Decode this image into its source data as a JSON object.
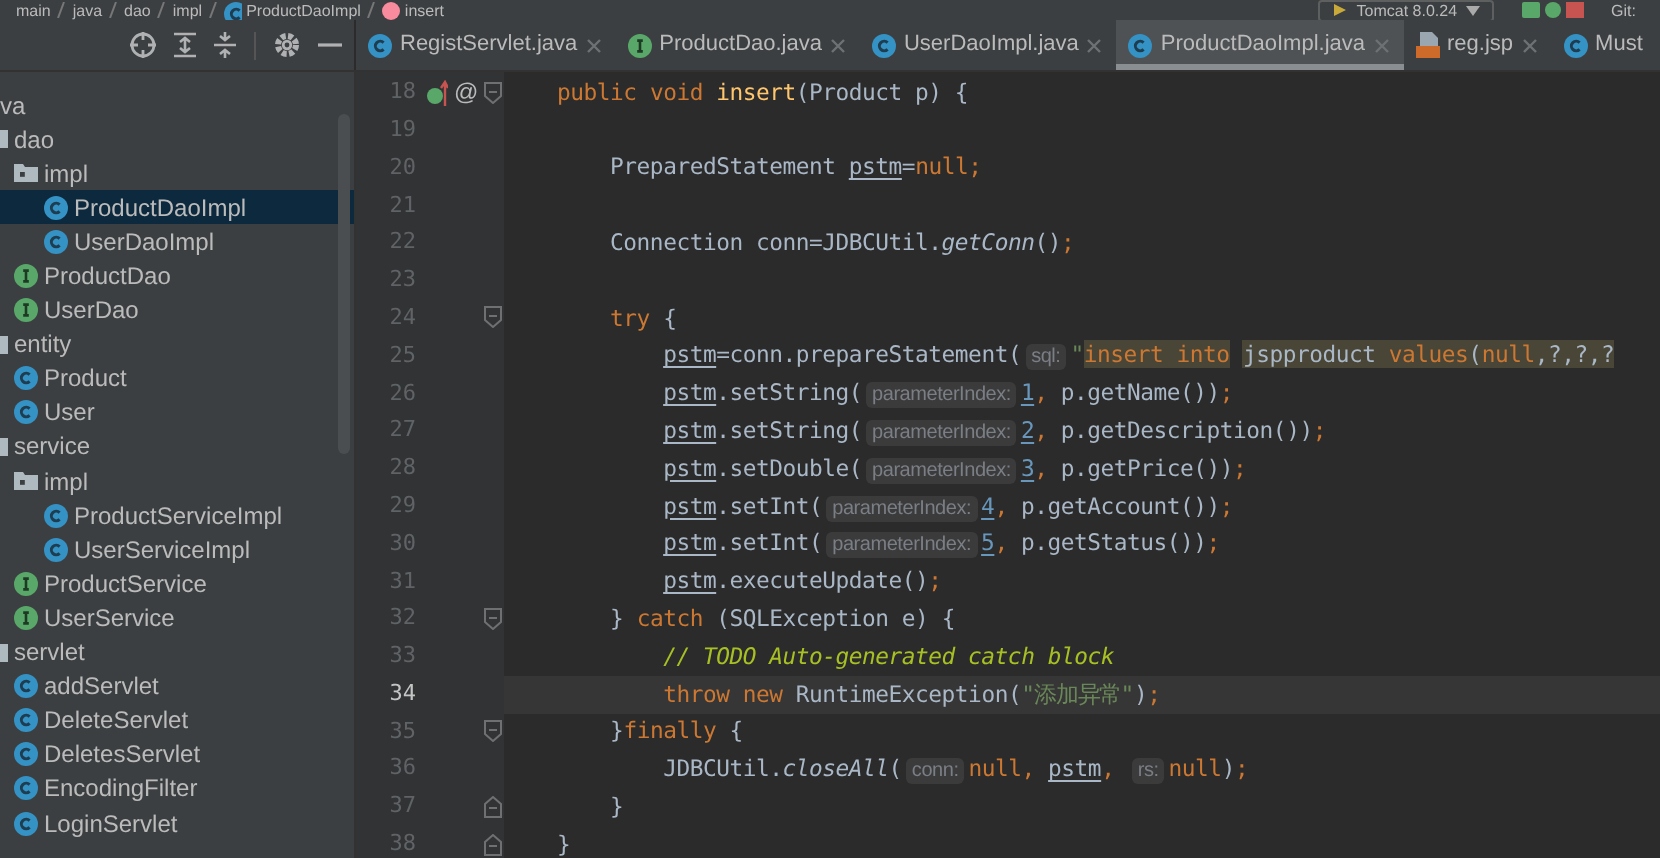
{
  "breadcrumb": [
    {
      "label": "main",
      "kind": "folder"
    },
    {
      "label": "java",
      "kind": "folder"
    },
    {
      "label": "dao",
      "kind": "folder"
    },
    {
      "label": "impl",
      "kind": "folder"
    },
    {
      "label": "ProductDaoImpl",
      "kind": "class"
    },
    {
      "label": "insert",
      "kind": "method"
    }
  ],
  "run_config": "Tomcat 8.0.24",
  "vcs_label": "Git:",
  "tabs": [
    {
      "label": "RegistServlet.java",
      "kind": "class",
      "selected": false
    },
    {
      "label": "ProductDao.java",
      "kind": "interface",
      "selected": false
    },
    {
      "label": "UserDaoImpl.java",
      "kind": "class",
      "selected": false
    },
    {
      "label": "ProductDaoImpl.java",
      "kind": "class",
      "selected": true
    },
    {
      "label": "reg.jsp",
      "kind": "jsp",
      "selected": false
    },
    {
      "label": "Must",
      "kind": "class",
      "selected": false
    }
  ],
  "project_tree": [
    {
      "label": "va",
      "selected": false,
      "children": [
        {
          "label": "dao",
          "kind": "package",
          "selected": false,
          "children": [
            {
              "label": "impl",
              "kind": "package",
              "selected": false,
              "children": [
                {
                  "label": "ProductDaoImpl",
                  "kind": "class",
                  "selected": true
                },
                {
                  "label": "UserDaoImpl",
                  "kind": "class",
                  "selected": false
                }
              ]
            },
            {
              "label": "ProductDao",
              "kind": "interface",
              "selected": false
            },
            {
              "label": "UserDao",
              "kind": "interface",
              "selected": false
            }
          ]
        },
        {
          "label": "entity",
          "kind": "package",
          "selected": false,
          "children": [
            {
              "label": "Product",
              "kind": "class",
              "selected": false
            },
            {
              "label": "User",
              "kind": "class",
              "selected": false
            }
          ]
        },
        {
          "label": "service",
          "kind": "package",
          "selected": false,
          "children": [
            {
              "label": "impl",
              "kind": "package",
              "selected": false,
              "children": [
                {
                  "label": "ProductServiceImpl",
                  "kind": "class",
                  "selected": false
                },
                {
                  "label": "UserServiceImpl",
                  "kind": "class",
                  "selected": false
                }
              ]
            },
            {
              "label": "ProductService",
              "kind": "interface",
              "selected": false
            },
            {
              "label": "UserService",
              "kind": "interface",
              "selected": false
            }
          ]
        },
        {
          "label": "servlet",
          "kind": "package",
          "selected": false,
          "children": [
            {
              "label": "addServlet",
              "kind": "class",
              "selected": false
            },
            {
              "label": "DeleteServlet",
              "kind": "class",
              "selected": false
            },
            {
              "label": "DeletesServlet",
              "kind": "class",
              "selected": false
            },
            {
              "label": "EncodingFilter",
              "kind": "class",
              "selected": false
            },
            {
              "label": "LoginServlet",
              "kind": "class",
              "selected": false
            }
          ]
        }
      ]
    }
  ],
  "editor": {
    "lines": [
      {
        "number": "18",
        "current": false,
        "fold_start": true,
        "implements_marker": true,
        "gutter_text": "@",
        "tokens": [
          {
            "kind": "kw",
            "text": "    public void "
          },
          {
            "kind": "decl",
            "text": "insert"
          },
          {
            "kind": "plain",
            "text": "(Product p) {"
          }
        ]
      },
      {
        "number": "19",
        "current": false
      },
      {
        "number": "20",
        "current": false,
        "tokens": [
          {
            "kind": "plain",
            "text": "        PreparedStatement "
          },
          {
            "kind": "var",
            "text": "pstm"
          },
          {
            "kind": "plain",
            "text": "="
          },
          {
            "kind": "kw",
            "text": "null"
          },
          {
            "kind": "punct",
            "text": ";"
          }
        ]
      },
      {
        "number": "21",
        "current": false
      },
      {
        "number": "22",
        "current": false,
        "tokens": [
          {
            "kind": "plain",
            "text": "        Connection conn=JDBCUtil."
          },
          {
            "kind": "static",
            "text": "getConn"
          },
          {
            "kind": "plain",
            "text": "()"
          },
          {
            "kind": "punct",
            "text": ";"
          }
        ]
      },
      {
        "number": "23",
        "current": false
      },
      {
        "number": "24",
        "current": false,
        "fold_start": true,
        "tokens": [
          {
            "kind": "kw",
            "text": "        try"
          },
          {
            "kind": "plain",
            "text": " {"
          }
        ]
      },
      {
        "number": "25",
        "current": false,
        "tokens": [
          {
            "kind": "var",
            "text": "            pstm"
          },
          {
            "kind": "plain",
            "text": "=conn.prepareStatement("
          },
          {
            "kind": "hint",
            "text": "sql:"
          },
          {
            "kind": "str",
            "text": "\""
          },
          {
            "kind": "sql_kw",
            "text": "insert into"
          },
          {
            "kind": "sql_plain",
            "text": " jspproduct "
          },
          {
            "kind": "sql_kw",
            "text": "values"
          },
          {
            "kind": "sql_plain",
            "text": "("
          },
          {
            "kind": "sql_kw",
            "text": "null"
          },
          {
            "kind": "sql_plain",
            "text": ",?,?,?"
          }
        ]
      },
      {
        "number": "26",
        "current": false,
        "tokens": [
          {
            "kind": "var",
            "text": "            pstm"
          },
          {
            "kind": "plain",
            "text": ".setString("
          },
          {
            "kind": "hint",
            "text": "parameterIndex:"
          },
          {
            "kind": "num",
            "text": "1"
          },
          {
            "kind": "punct",
            "text": ","
          },
          {
            "kind": "plain",
            "text": " p.getName())"
          },
          {
            "kind": "punct",
            "text": ";"
          }
        ]
      },
      {
        "number": "27",
        "current": false,
        "tokens": [
          {
            "kind": "var",
            "text": "            pstm"
          },
          {
            "kind": "plain",
            "text": ".setString("
          },
          {
            "kind": "hint",
            "text": "parameterIndex:"
          },
          {
            "kind": "num",
            "text": "2"
          },
          {
            "kind": "punct",
            "text": ","
          },
          {
            "kind": "plain",
            "text": " p.getDescription())"
          },
          {
            "kind": "punct",
            "text": ";"
          }
        ]
      },
      {
        "number": "28",
        "current": false,
        "tokens": [
          {
            "kind": "var",
            "text": "            pstm"
          },
          {
            "kind": "plain",
            "text": ".setDouble("
          },
          {
            "kind": "hint",
            "text": "parameterIndex:"
          },
          {
            "kind": "num",
            "text": "3"
          },
          {
            "kind": "punct",
            "text": ","
          },
          {
            "kind": "plain",
            "text": " p.getPrice())"
          },
          {
            "kind": "punct",
            "text": ";"
          }
        ]
      },
      {
        "number": "29",
        "current": false,
        "tokens": [
          {
            "kind": "var",
            "text": "            pstm"
          },
          {
            "kind": "plain",
            "text": ".setInt("
          },
          {
            "kind": "hint",
            "text": "parameterIndex:"
          },
          {
            "kind": "num",
            "text": "4"
          },
          {
            "kind": "punct",
            "text": ","
          },
          {
            "kind": "plain",
            "text": " p.getAccount())"
          },
          {
            "kind": "punct",
            "text": ";"
          }
        ]
      },
      {
        "number": "30",
        "current": false,
        "tokens": [
          {
            "kind": "var",
            "text": "            pstm"
          },
          {
            "kind": "plain",
            "text": ".setInt("
          },
          {
            "kind": "hint",
            "text": "parameterIndex:"
          },
          {
            "kind": "num",
            "text": "5"
          },
          {
            "kind": "punct",
            "text": ","
          },
          {
            "kind": "plain",
            "text": " p.getStatus())"
          },
          {
            "kind": "punct",
            "text": ";"
          }
        ]
      },
      {
        "number": "31",
        "current": false,
        "tokens": [
          {
            "kind": "var",
            "text": "            pstm"
          },
          {
            "kind": "plain",
            "text": ".executeUpdate()"
          },
          {
            "kind": "punct",
            "text": ";"
          }
        ]
      },
      {
        "number": "32",
        "current": false,
        "fold_start": true,
        "tokens": [
          {
            "kind": "plain",
            "text": "        } "
          },
          {
            "kind": "kw",
            "text": "catch"
          },
          {
            "kind": "plain",
            "text": " (SQLException e) {"
          }
        ]
      },
      {
        "number": "33",
        "current": false,
        "tokens": [
          {
            "kind": "comment",
            "text": "            // TODO Auto-generated catch block"
          }
        ]
      },
      {
        "number": "34",
        "current": true,
        "tokens": [
          {
            "kind": "kw",
            "text": "            throw new"
          },
          {
            "kind": "plain",
            "text": " RuntimeException("
          },
          {
            "kind": "str",
            "text": "\"添加异常\""
          },
          {
            "kind": "plain",
            "text": ")"
          },
          {
            "kind": "punct",
            "text": ";"
          }
        ]
      },
      {
        "number": "35",
        "current": false,
        "fold_start": true,
        "tokens": [
          {
            "kind": "plain",
            "text": "        }"
          },
          {
            "kind": "kw",
            "text": "finally"
          },
          {
            "kind": "plain",
            "text": " {"
          }
        ]
      },
      {
        "number": "36",
        "current": false,
        "tokens": [
          {
            "kind": "plain",
            "text": "            JDBCUtil."
          },
          {
            "kind": "static",
            "text": "closeAll"
          },
          {
            "kind": "plain",
            "text": "("
          },
          {
            "kind": "hint",
            "text": "conn:"
          },
          {
            "kind": "kw",
            "text": "null"
          },
          {
            "kind": "punct",
            "text": ", "
          },
          {
            "kind": "var",
            "text": "pstm"
          },
          {
            "kind": "punct",
            "text": ", "
          },
          {
            "kind": "hint",
            "text": "rs:"
          },
          {
            "kind": "kw",
            "text": "null"
          },
          {
            "kind": "plain",
            "text": ")"
          },
          {
            "kind": "punct",
            "text": ";"
          }
        ]
      },
      {
        "number": "37",
        "current": false,
        "fold_end": true,
        "tokens": [
          {
            "kind": "plain",
            "text": "        }"
          }
        ]
      },
      {
        "number": "38",
        "current": false,
        "fold_end": true,
        "tokens": [
          {
            "kind": "plain",
            "text": "    }"
          }
        ]
      }
    ]
  }
}
